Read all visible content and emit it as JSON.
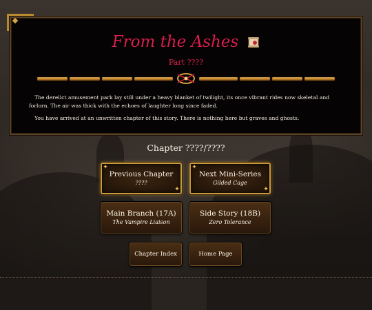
{
  "story": {
    "title": "From the Ashes",
    "title_icon": "scroll-icon",
    "part": "Part ????",
    "paragraphs": [
      "The derelict amusement park lay still under a heavy blanket of twilight, its once vibrant rides now skeletal and forlorn. The air was thick with the echoes of laughter long since faded.",
      "You have arrived at an unwritten chapter of this story. There is nothing here but graves and ghosts."
    ]
  },
  "chapter": {
    "label": "Chapter ????/????"
  },
  "nav": {
    "previous": {
      "label": "Previous Chapter",
      "sub": "????"
    },
    "next": {
      "label": "Next Mini-Series",
      "sub": "Gilded Cage"
    },
    "main_branch": {
      "label": "Main Branch (17A)",
      "sub": "The Vampire Liaison"
    },
    "side_story": {
      "label": "Side Story (18B)",
      "sub": "Zero Tolerance"
    },
    "index": {
      "label": "Chapter Index"
    },
    "home": {
      "label": "Home Page"
    }
  },
  "colors": {
    "title": "#d91e4e",
    "gold": "#c99a3a",
    "text": "#f3ece2"
  }
}
